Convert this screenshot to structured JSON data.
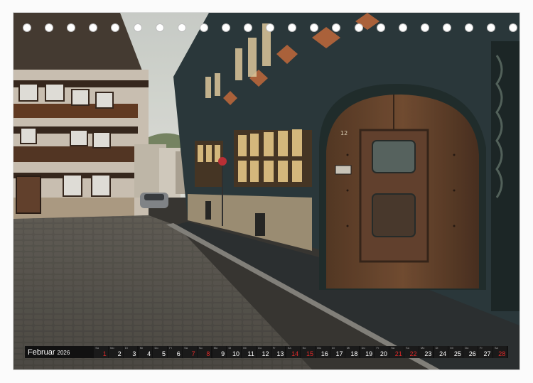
{
  "calendar": {
    "month": "Februar",
    "year": "2026",
    "days": [
      {
        "wd": "So",
        "num": "1",
        "red": true
      },
      {
        "wd": "Mo",
        "num": "2",
        "red": false
      },
      {
        "wd": "Di",
        "num": "3",
        "red": false
      },
      {
        "wd": "Mi",
        "num": "4",
        "red": false
      },
      {
        "wd": "Do",
        "num": "5",
        "red": false
      },
      {
        "wd": "Fr",
        "num": "6",
        "red": false
      },
      {
        "wd": "Sa",
        "num": "7",
        "red": true
      },
      {
        "wd": "So",
        "num": "8",
        "red": true
      },
      {
        "wd": "Mo",
        "num": "9",
        "red": false
      },
      {
        "wd": "Di",
        "num": "10",
        "red": false
      },
      {
        "wd": "Mi",
        "num": "11",
        "red": false
      },
      {
        "wd": "Do",
        "num": "12",
        "red": false
      },
      {
        "wd": "Fr",
        "num": "13",
        "red": false
      },
      {
        "wd": "Sa",
        "num": "14",
        "red": true
      },
      {
        "wd": "So",
        "num": "15",
        "red": true
      },
      {
        "wd": "Mo",
        "num": "16",
        "red": false
      },
      {
        "wd": "Di",
        "num": "17",
        "red": false
      },
      {
        "wd": "Mi",
        "num": "18",
        "red": false
      },
      {
        "wd": "Do",
        "num": "19",
        "red": false
      },
      {
        "wd": "Fr",
        "num": "20",
        "red": false
      },
      {
        "wd": "Sa",
        "num": "21",
        "red": true
      },
      {
        "wd": "So",
        "num": "22",
        "red": true
      },
      {
        "wd": "Mo",
        "num": "23",
        "red": false
      },
      {
        "wd": "Di",
        "num": "24",
        "red": false
      },
      {
        "wd": "Mi",
        "num": "25",
        "red": false
      },
      {
        "wd": "Do",
        "num": "26",
        "red": false
      },
      {
        "wd": "Fr",
        "num": "27",
        "red": false
      },
      {
        "wd": "Sa",
        "num": "28",
        "red": true
      }
    ]
  },
  "photo": {
    "door_number": "12"
  },
  "colors": {
    "bar": "#111111",
    "weekend": "#e02a2a"
  }
}
